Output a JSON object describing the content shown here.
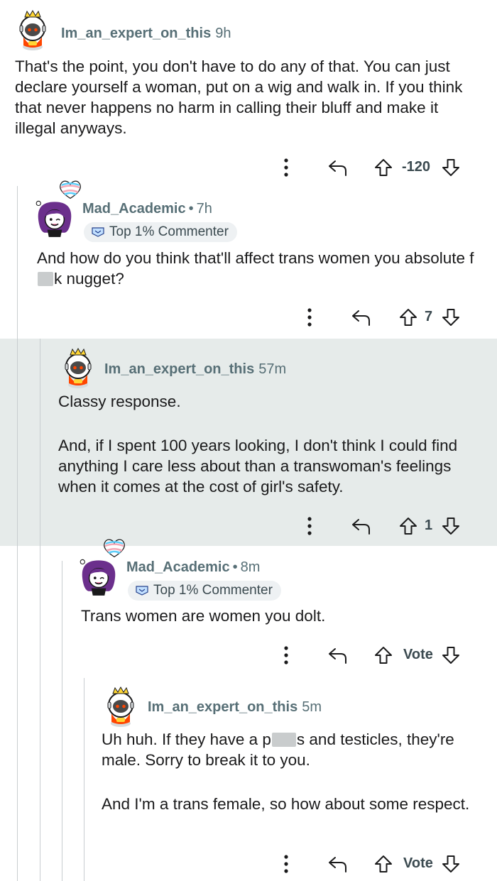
{
  "comments": [
    {
      "username": "Im_an_expert_on_this",
      "time": "9h",
      "text": [
        "That's the point, you don't have to do any of that. You can just declare yourself a woman, put on a wig and walk in. If you think that never happens no harm in calling their bluff and make it illegal anyways."
      ],
      "vote_label": "-120"
    },
    {
      "username": "Mad_Academic",
      "time": "7h",
      "badge": "Top 1% Commenter",
      "text_before_censor": "And how do you think that'll affect trans women you absolute f",
      "text_after_censor": "k nugget?",
      "vote_label": "7"
    },
    {
      "username": "Im_an_expert_on_this",
      "time": "57m",
      "text": [
        "Classy response.",
        "And, if I spent 100 years looking, I don't think I could find anything I care less about than a transwoman's feelings when it comes at the cost of girl's safety."
      ],
      "vote_label": "1"
    },
    {
      "username": "Mad_Academic",
      "time": "8m",
      "badge": "Top 1% Commenter",
      "text": [
        "Trans women are women you dolt."
      ],
      "vote_label": "Vote"
    },
    {
      "username": "Im_an_expert_on_this",
      "time": "5m",
      "text_before_censor": "Uh huh. If they have a p",
      "text_after_censor": "s and testicles, they're male. Sorry to break it to you.",
      "text2": "And I'm a trans female, so how about some respect.",
      "vote_label": "Vote"
    }
  ],
  "colors": {
    "highlight": "#e6ebea",
    "meta": "#576f76",
    "text": "#1a1a1b"
  },
  "icons": [
    "more-options-icon",
    "reply-icon",
    "upvote-icon",
    "downvote-icon",
    "astronaut-avatar",
    "purple-hair-avatar",
    "trans-heart-icon",
    "badge-icon"
  ]
}
